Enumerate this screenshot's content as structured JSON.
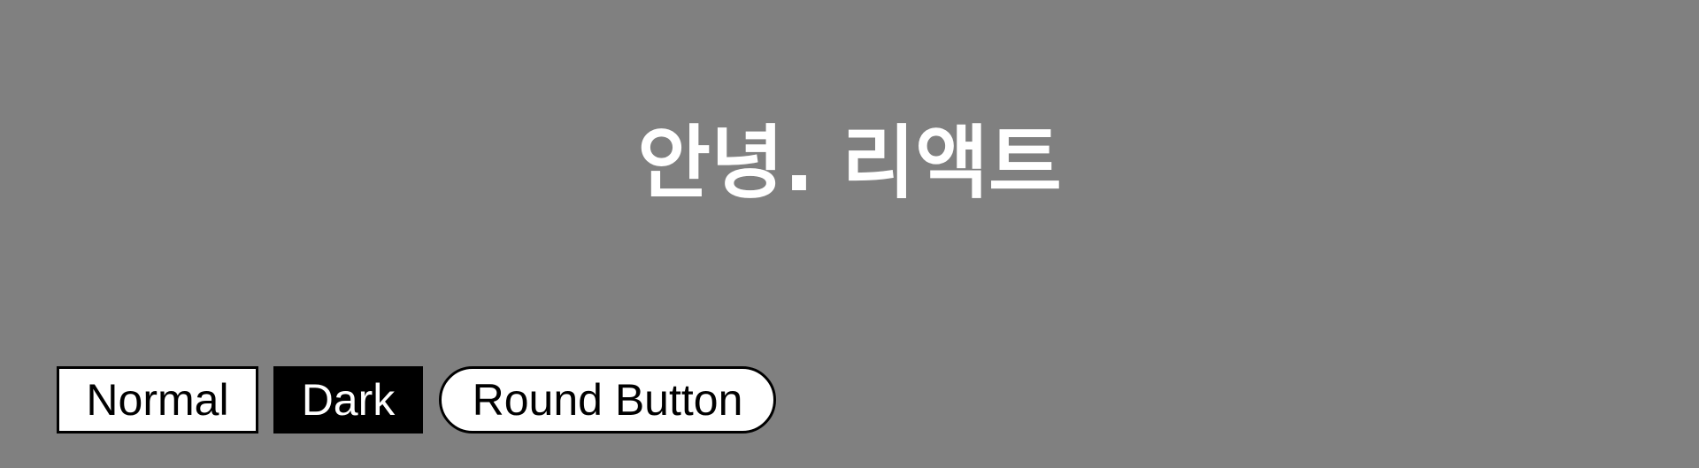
{
  "page": {
    "title": "안녕. 리액트",
    "background_color": "#808080"
  },
  "buttons": {
    "normal": {
      "label": "Normal",
      "background": "#ffffff",
      "text_color": "#000000"
    },
    "dark": {
      "label": "Dark",
      "background": "#000000",
      "text_color": "#ffffff"
    },
    "round": {
      "label": "Round Button",
      "background": "#ffffff",
      "text_color": "#000000"
    }
  }
}
